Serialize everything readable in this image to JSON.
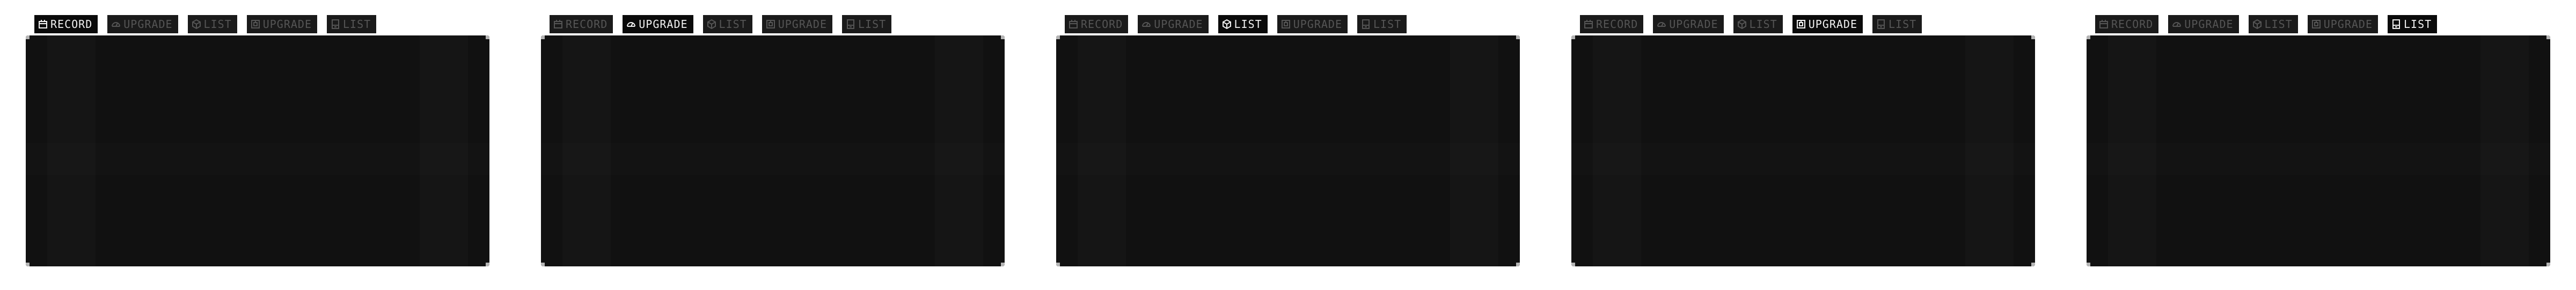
{
  "tab_labels": [
    "RECORD",
    "UPGRADE",
    "LIST",
    "UPGRADE",
    "LIST"
  ],
  "tab_icons": [
    "calendar-icon",
    "gauge-icon",
    "package-icon",
    "chip-icon",
    "device-icon"
  ],
  "colors": {
    "page_background": "#ffffff",
    "tab_background": "#1a1a1a",
    "tab_active_background": "#0a0a0a",
    "tab_text": "#555555",
    "tab_active_text": "#f2f2f2",
    "panel_background": "#111111",
    "panel_corner": "#b5b5b5"
  },
  "screens": [
    {
      "active_tab": 0,
      "tabs": [
        {
          "label": "RECORD"
        },
        {
          "label": "UPGRADE"
        },
        {
          "label": "LIST"
        },
        {
          "label": "UPGRADE"
        },
        {
          "label": "LIST"
        }
      ]
    },
    {
      "active_tab": 1,
      "tabs": [
        {
          "label": "RECORD"
        },
        {
          "label": "UPGRADE"
        },
        {
          "label": "LIST"
        },
        {
          "label": "UPGRADE"
        },
        {
          "label": "LIST"
        }
      ]
    },
    {
      "active_tab": 2,
      "tabs": [
        {
          "label": "RECORD"
        },
        {
          "label": "UPGRADE"
        },
        {
          "label": "LIST"
        },
        {
          "label": "UPGRADE"
        },
        {
          "label": "LIST"
        }
      ]
    },
    {
      "active_tab": 3,
      "tabs": [
        {
          "label": "RECORD"
        },
        {
          "label": "UPGRADE"
        },
        {
          "label": "LIST"
        },
        {
          "label": "UPGRADE"
        },
        {
          "label": "LIST"
        }
      ]
    },
    {
      "active_tab": 4,
      "tabs": [
        {
          "label": "RECORD"
        },
        {
          "label": "UPGRADE"
        },
        {
          "label": "LIST"
        },
        {
          "label": "UPGRADE"
        },
        {
          "label": "LIST"
        }
      ]
    }
  ]
}
